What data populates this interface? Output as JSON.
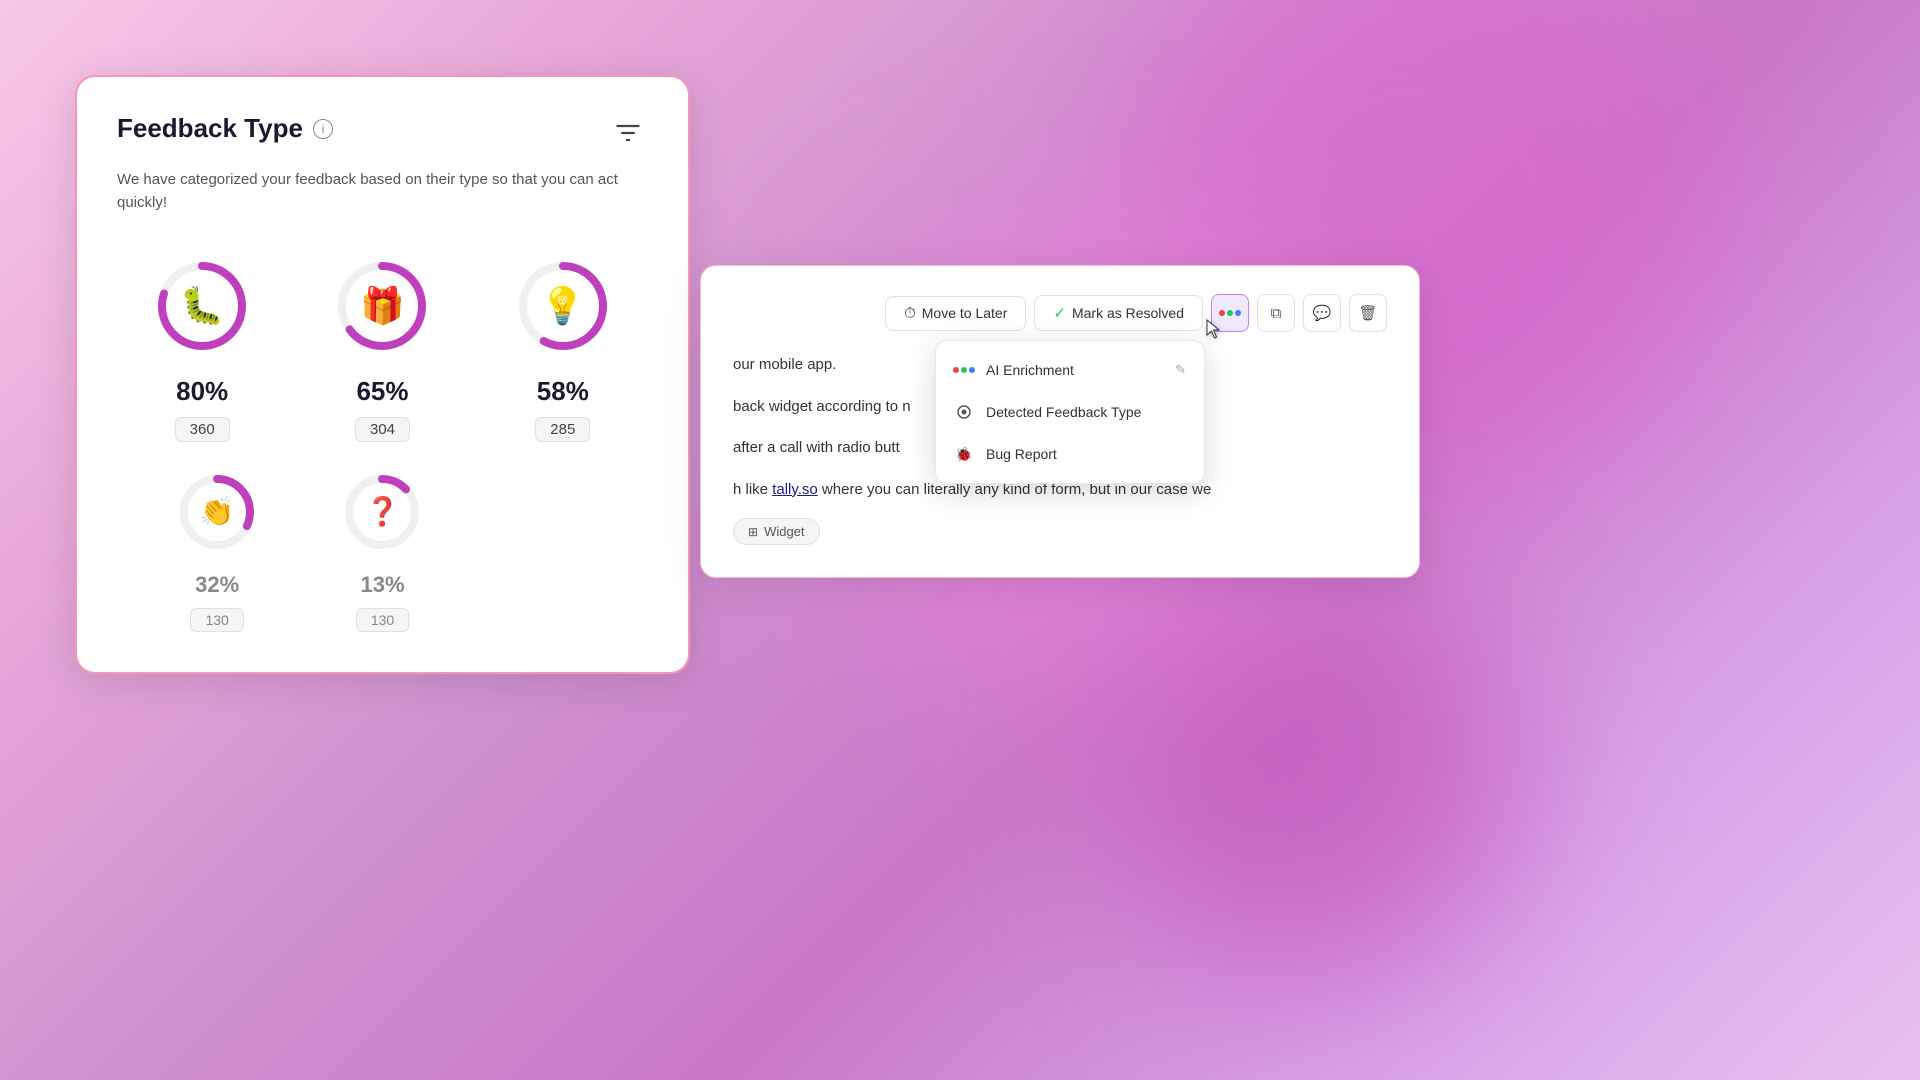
{
  "background": {
    "colors": [
      "#e870d0",
      "#c040b0",
      "#f080e0"
    ]
  },
  "feedbackCard": {
    "title": "Feedback Type",
    "description": "We have categorized your feedback based on their type so that you can act quickly!",
    "items": [
      {
        "emoji": "🐛",
        "percent": "80%",
        "count": "360",
        "dasharray": "251.2",
        "offset": "0",
        "filled": 251
      },
      {
        "emoji": "🎁",
        "percent": "65%",
        "count": "304",
        "dasharray": "251.2",
        "filled": 163
      },
      {
        "emoji": "💡",
        "percent": "58%",
        "count": "285",
        "dasharray": "251.2",
        "filled": 146
      },
      {
        "emoji": "👏",
        "percent": "32%",
        "count": "130",
        "partial": true,
        "filled": 80
      },
      {
        "emoji": "❓",
        "percent": "13%",
        "count": "130",
        "partial": true,
        "filled": 33
      }
    ],
    "circumference": 251.2
  },
  "detailPanel": {
    "toolbar": {
      "moveToLater": "Move to Later",
      "markAsResolved": "Mark as Resolved",
      "dotsLabel": "dots",
      "copyLabel": "copy",
      "commentLabel": "comment",
      "deleteLabel": "delete"
    },
    "textParts": [
      "our mobile app.",
      "back widget according to n",
      "after a call with radio butt",
      "h like ",
      "tally.so",
      " where you can literally any kind of form, but in our case we"
    ],
    "tag": "Widget"
  },
  "dropdown": {
    "items": [
      {
        "label": "AI Enrichment",
        "icon": "ai",
        "editable": true
      },
      {
        "label": "Detected Feedback Type",
        "icon": "circle",
        "editable": false
      },
      {
        "label": "Bug Report",
        "icon": "bug",
        "editable": false
      }
    ]
  }
}
